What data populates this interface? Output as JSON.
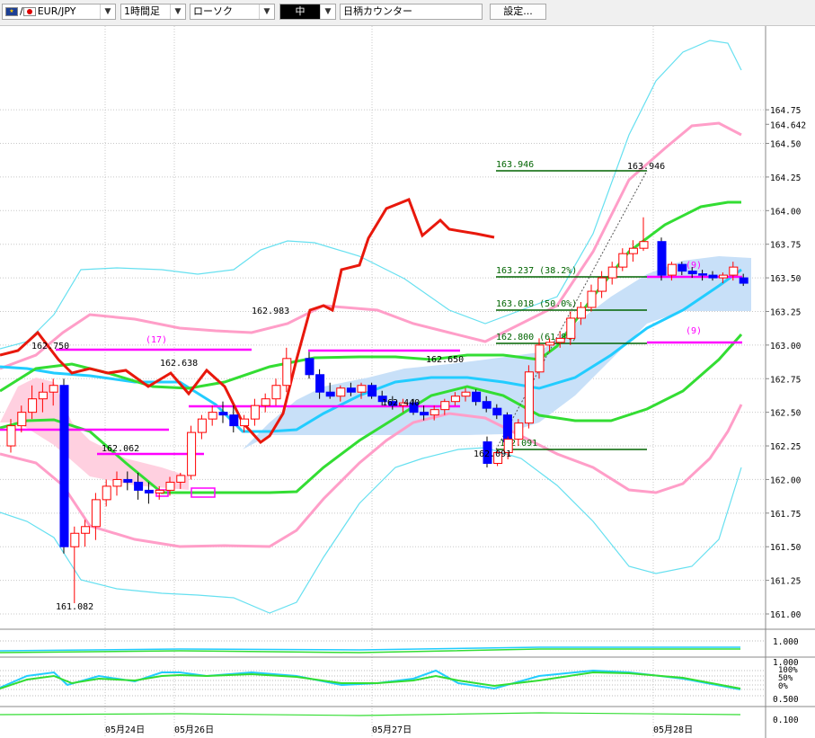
{
  "toolbar": {
    "symbol": "EUR/JPY",
    "symbol_prefix": "/",
    "timeframe": "1時間足",
    "chart_type": "ローソク",
    "size": "中",
    "counter_input": "日柄カウンター",
    "settings_label": "設定..."
  },
  "chart_data": {
    "type": "candlestick",
    "symbol": "EUR/JPY",
    "timeframe": "1H",
    "ylim": [
      160.85,
      164.95
    ],
    "price_ticks": [
      "164.75",
      "164.642",
      "164.50",
      "164.25",
      "164.00",
      "163.75",
      "163.50",
      "163.25",
      "163.00",
      "162.75",
      "162.50",
      "162.25",
      "162.00",
      "161.75",
      "161.50",
      "161.25",
      "161.00"
    ],
    "date_labels": [
      "05月24日",
      "05月26日",
      "05月27日",
      "05月28日"
    ],
    "candles": [
      [
        162.25,
        162.45,
        162.2,
        162.4
      ],
      [
        162.4,
        162.55,
        162.35,
        162.5
      ],
      [
        162.5,
        162.7,
        162.45,
        162.6
      ],
      [
        162.6,
        162.72,
        162.5,
        162.65
      ],
      [
        162.65,
        162.75,
        162.55,
        162.7
      ],
      [
        162.7,
        162.75,
        161.45,
        161.5
      ],
      [
        161.5,
        161.65,
        161.08,
        161.6
      ],
      [
        161.6,
        161.7,
        161.5,
        161.65
      ],
      [
        161.65,
        161.9,
        161.55,
        161.85
      ],
      [
        161.85,
        162.0,
        161.8,
        161.95
      ],
      [
        161.95,
        162.06,
        161.88,
        162.0
      ],
      [
        162.0,
        162.06,
        161.92,
        161.98
      ],
      [
        161.98,
        162.05,
        161.85,
        161.92
      ],
      [
        161.92,
        161.98,
        161.82,
        161.9
      ],
      [
        161.9,
        161.95,
        161.85,
        161.92
      ],
      [
        161.92,
        162.02,
        161.88,
        161.98
      ],
      [
        161.98,
        162.05,
        161.93,
        162.03
      ],
      [
        162.03,
        162.4,
        162.0,
        162.35
      ],
      [
        162.35,
        162.48,
        162.3,
        162.45
      ],
      [
        162.45,
        162.55,
        162.4,
        162.5
      ],
      [
        162.5,
        162.58,
        162.42,
        162.48
      ],
      [
        162.48,
        162.55,
        162.35,
        162.4
      ],
      [
        162.4,
        162.48,
        162.35,
        162.45
      ],
      [
        162.45,
        162.6,
        162.4,
        162.55
      ],
      [
        162.55,
        162.64,
        162.5,
        162.6
      ],
      [
        162.6,
        162.75,
        162.55,
        162.7
      ],
      [
        162.7,
        162.98,
        162.65,
        162.9
      ],
      [
        162.9,
        162.95,
        162.75,
        162.78
      ],
      [
        162.78,
        162.82,
        162.6,
        162.65
      ],
      [
        162.65,
        162.72,
        162.6,
        162.62
      ],
      [
        162.62,
        162.7,
        162.58,
        162.68
      ],
      [
        162.68,
        162.72,
        162.62,
        162.65
      ],
      [
        162.65,
        162.72,
        162.6,
        162.7
      ],
      [
        162.7,
        162.72,
        162.6,
        162.62
      ],
      [
        162.62,
        162.66,
        162.55,
        162.58
      ],
      [
        162.58,
        162.62,
        162.52,
        162.55
      ],
      [
        162.55,
        162.6,
        162.5,
        162.57
      ],
      [
        162.57,
        162.6,
        162.48,
        162.5
      ],
      [
        162.5,
        162.55,
        162.44,
        162.48
      ],
      [
        162.48,
        162.55,
        162.44,
        162.52
      ],
      [
        162.52,
        162.6,
        162.48,
        162.58
      ],
      [
        162.58,
        162.65,
        162.55,
        162.62
      ],
      [
        162.62,
        162.68,
        162.58,
        162.65
      ],
      [
        162.65,
        162.67,
        162.55,
        162.58
      ],
      [
        162.58,
        162.62,
        162.5,
        162.53
      ],
      [
        162.53,
        162.56,
        162.45,
        162.48
      ],
      [
        162.48,
        162.5,
        162.25,
        162.28
      ],
      [
        162.28,
        162.32,
        162.09,
        162.12
      ],
      [
        162.12,
        162.22,
        162.1,
        162.2
      ],
      [
        162.2,
        162.32,
        162.15,
        162.3
      ],
      [
        162.3,
        162.45,
        162.25,
        162.42
      ],
      [
        162.42,
        162.85,
        162.38,
        162.8
      ],
      [
        162.8,
        163.05,
        162.75,
        163.0
      ],
      [
        163.0,
        163.05,
        162.95,
        163.02
      ],
      [
        163.02,
        163.1,
        162.98,
        163.05
      ],
      [
        163.05,
        163.25,
        163.0,
        163.2
      ],
      [
        163.2,
        163.32,
        163.15,
        163.28
      ],
      [
        163.28,
        163.45,
        163.25,
        163.4
      ],
      [
        163.4,
        163.55,
        163.35,
        163.5
      ],
      [
        163.5,
        163.62,
        163.45,
        163.58
      ],
      [
        163.58,
        163.72,
        163.55,
        163.68
      ],
      [
        163.68,
        163.78,
        163.62,
        163.72
      ],
      [
        163.72,
        163.95,
        163.7,
        163.77
      ],
      [
        163.77,
        163.8,
        163.48,
        163.52
      ],
      [
        163.52,
        163.62,
        163.48,
        163.6
      ],
      [
        163.6,
        163.62,
        163.52,
        163.55
      ],
      [
        163.55,
        163.58,
        163.5,
        163.53
      ],
      [
        163.53,
        163.56,
        163.48,
        163.52
      ],
      [
        163.52,
        163.55,
        163.48,
        163.5
      ],
      [
        163.5,
        163.54,
        163.46,
        163.52
      ],
      [
        163.52,
        163.62,
        163.48,
        163.58
      ],
      [
        163.5,
        163.53,
        163.44,
        163.46
      ]
    ],
    "price_labels": [
      "162.750",
      "162.638",
      "162.062",
      "161.082",
      "162.983",
      "162.650",
      "162.440",
      "162.091",
      "163.946"
    ],
    "fibonacci": {
      "high_label": "163.946",
      "levels": [
        "163.237 (38.2%)",
        "163.018 (50.0%)",
        "162.800 (61.8%)"
      ],
      "low_label": "162.091",
      "values": [
        163.946,
        163.237,
        163.018,
        162.8,
        162.091
      ]
    },
    "resistance_lines": [
      {
        "label": "(17)",
        "value": 162.74
      },
      {
        "label": "(9)",
        "value": 163.24
      },
      {
        "label": "(9)",
        "value": 162.8
      }
    ],
    "support_lines": [
      162.22,
      162.05,
      162.38
    ],
    "lagging_span_values": [
      162.55,
      162.75,
      162.9,
      162.8,
      162.7,
      162.6,
      162.65,
      162.62,
      162.62,
      162.55,
      162.45,
      162.55,
      162.62,
      162.48,
      162.52,
      162.7,
      162.62,
      162.52,
      162.3,
      162.2,
      162.15,
      162.25,
      162.35,
      162.75,
      162.95,
      163.05,
      163.0,
      163.25,
      163.35,
      163.55,
      163.65,
      163.7,
      163.72,
      163.55,
      163.52,
      163.55,
      163.53,
      163.52,
      163.51,
      163.5
    ],
    "oscillator_labels": [
      "1.000",
      "100%",
      "50%",
      "0%",
      "0.500",
      "0.100"
    ],
    "colors": {
      "up_candle": "#ff0000",
      "down_candle": "#0000ff",
      "lagging_span": "#e8180c",
      "bb1": "#ff9ec8",
      "bb2": "#66e0f0",
      "mid": "#22ccff",
      "ma": "#33dd33",
      "cloud": "#c8e0f8",
      "cloud_pink": "#ffd0e0",
      "fib": "#006400",
      "magenta": "#ff00ff"
    }
  }
}
